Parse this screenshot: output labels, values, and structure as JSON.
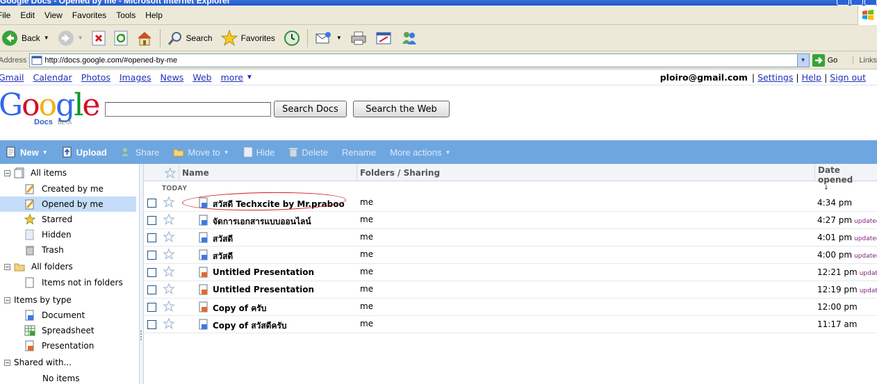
{
  "window": {
    "title": "Google Docs - Opened by me - Microsoft Internet Explorer"
  },
  "menu": [
    "File",
    "Edit",
    "View",
    "Favorites",
    "Tools",
    "Help"
  ],
  "toolbar": {
    "back": "Back",
    "search": "Search",
    "favorites": "Favorites"
  },
  "address": {
    "label": "Address",
    "url": "http://docs.google.com/#opened-by-me",
    "go": "Go",
    "links": "Links"
  },
  "gnav": {
    "links": [
      "Gmail",
      "Calendar",
      "Photos",
      "Images",
      "News",
      "Web",
      "more"
    ],
    "user": "ploiro@gmail.com",
    "settings": "Settings",
    "help": "Help",
    "signout": "Sign out",
    "sep": "|"
  },
  "logo": {
    "docs": "Docs",
    "beta": "BETA"
  },
  "search": {
    "docs_button": "Search Docs",
    "web_button": "Search the Web"
  },
  "actions": {
    "new": "New",
    "upload": "Upload",
    "share": "Share",
    "move_to": "Move to",
    "hide": "Hide",
    "delete": "Delete",
    "rename": "Rename",
    "more_actions": "More actions"
  },
  "sidebar": {
    "all_items": "All items",
    "created_by_me": "Created by me",
    "opened_by_me": "Opened by me",
    "starred": "Starred",
    "hidden": "Hidden",
    "trash": "Trash",
    "all_folders": "All folders",
    "items_not_in_folders": "Items not in folders",
    "items_by_type": "Items by type",
    "document": "Document",
    "spreadsheet": "Spreadsheet",
    "presentation": "Presentation",
    "shared_with": "Shared with...",
    "no_items": "No items"
  },
  "list": {
    "col_name": "Name",
    "col_folders": "Folders / Sharing",
    "col_date": "Date opened",
    "sort_indicator": "↓",
    "group_today": "TODAY",
    "updated": "updated",
    "rows": [
      {
        "name": "สวัสดี Techxcite by Mr.praboo",
        "owner": "me",
        "date": "4:34 pm",
        "updated": "",
        "type": "doc"
      },
      {
        "name": "จัดการเอกสารแบบออนไลน์",
        "owner": "me",
        "date": "4:27 pm",
        "updated": "updated",
        "type": "doc"
      },
      {
        "name": "สวัสดี",
        "owner": "me",
        "date": "4:01 pm",
        "updated": "updated",
        "type": "doc"
      },
      {
        "name": "สวัสดี",
        "owner": "me",
        "date": "4:00 pm",
        "updated": "updated",
        "type": "doc"
      },
      {
        "name": "Untitled Presentation",
        "owner": "me",
        "date": "12:21 pm",
        "updated": "updated",
        "type": "pres"
      },
      {
        "name": "Untitled Presentation",
        "owner": "me",
        "date": "12:19 pm",
        "updated": "updated",
        "type": "pres"
      },
      {
        "name": "Copy of ครับ",
        "owner": "me",
        "date": "12:00 pm",
        "updated": "",
        "type": "pres"
      },
      {
        "name": "Copy of สวัสดีครับ",
        "owner": "me",
        "date": "11:17 am",
        "updated": "",
        "type": "doc"
      }
    ]
  },
  "colors": {
    "action_bar": "#6ea6e0",
    "selected": "#c5ddf8",
    "link": "#1f2fbe",
    "updated": "#7d1f7a",
    "annotation": "#d21a1a"
  }
}
